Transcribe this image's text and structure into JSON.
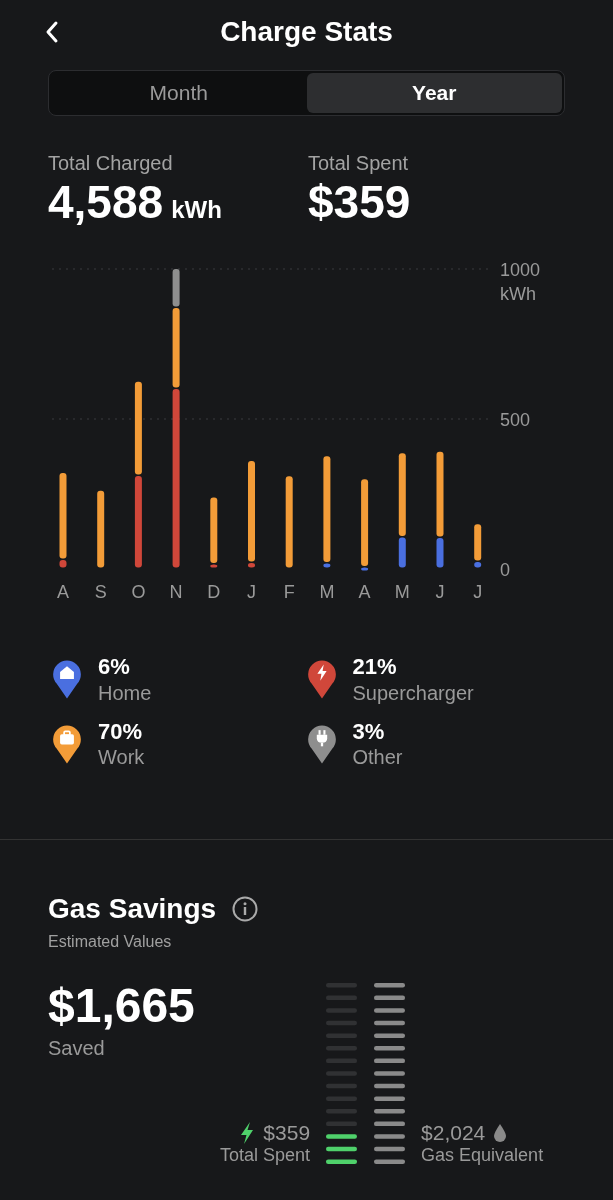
{
  "header": {
    "title": "Charge Stats"
  },
  "tabs": [
    {
      "label": "Month",
      "selected": false
    },
    {
      "label": "Year",
      "selected": true
    }
  ],
  "totals": [
    {
      "label": "Total Charged",
      "value": "4,588",
      "unit": "kWh"
    },
    {
      "label": "Total Spent",
      "value": "$359"
    }
  ],
  "chart_data": {
    "type": "bar",
    "stacked": true,
    "ylabel": "kWh",
    "ylim": [
      0,
      1000
    ],
    "yticks": [
      {
        "value": 0,
        "label": "0"
      },
      {
        "value": 500,
        "label": "500"
      },
      {
        "value": 1000,
        "label": "1000"
      }
    ],
    "categories": [
      "A",
      "S",
      "O",
      "N",
      "D",
      "J",
      "F",
      "M",
      "A",
      "M",
      "J",
      "J"
    ],
    "series": [
      {
        "name": "Home",
        "color": "#4a6fe0",
        "values": [
          0,
          0,
          0,
          0,
          0,
          0,
          0,
          18,
          5,
          105,
          103,
          23
        ]
      },
      {
        "name": "Supercharger",
        "color": "#d0473a",
        "values": [
          30,
          0,
          310,
          600,
          15,
          20,
          0,
          0,
          0,
          0,
          0,
          0
        ]
      },
      {
        "name": "Work",
        "color": "#f39c38",
        "values": [
          290,
          261,
          314,
          270,
          223,
          340,
          309,
          358,
          294,
          281,
          288,
          126
        ]
      },
      {
        "name": "Other",
        "color": "#8e8e8e",
        "values": [
          0,
          0,
          0,
          130,
          0,
          0,
          0,
          0,
          0,
          0,
          0,
          0
        ]
      }
    ]
  },
  "legend": [
    {
      "kind": "home",
      "percent": "6%"
    },
    {
      "kind": "supercharger",
      "percent": "21%"
    },
    {
      "kind": "work",
      "percent": "70%"
    },
    {
      "kind": "other",
      "percent": "3%"
    }
  ],
  "gas_savings": {
    "title": "Gas Savings",
    "subtitle": "Estimated Values",
    "amount": "$1,665",
    "amount_label": "Saved",
    "spent": {
      "value": "$359",
      "label": "Total Spent",
      "level": 0.2
    },
    "gas": {
      "value": "$2,024",
      "label": "Gas Equivalent",
      "level": 1
    }
  }
}
